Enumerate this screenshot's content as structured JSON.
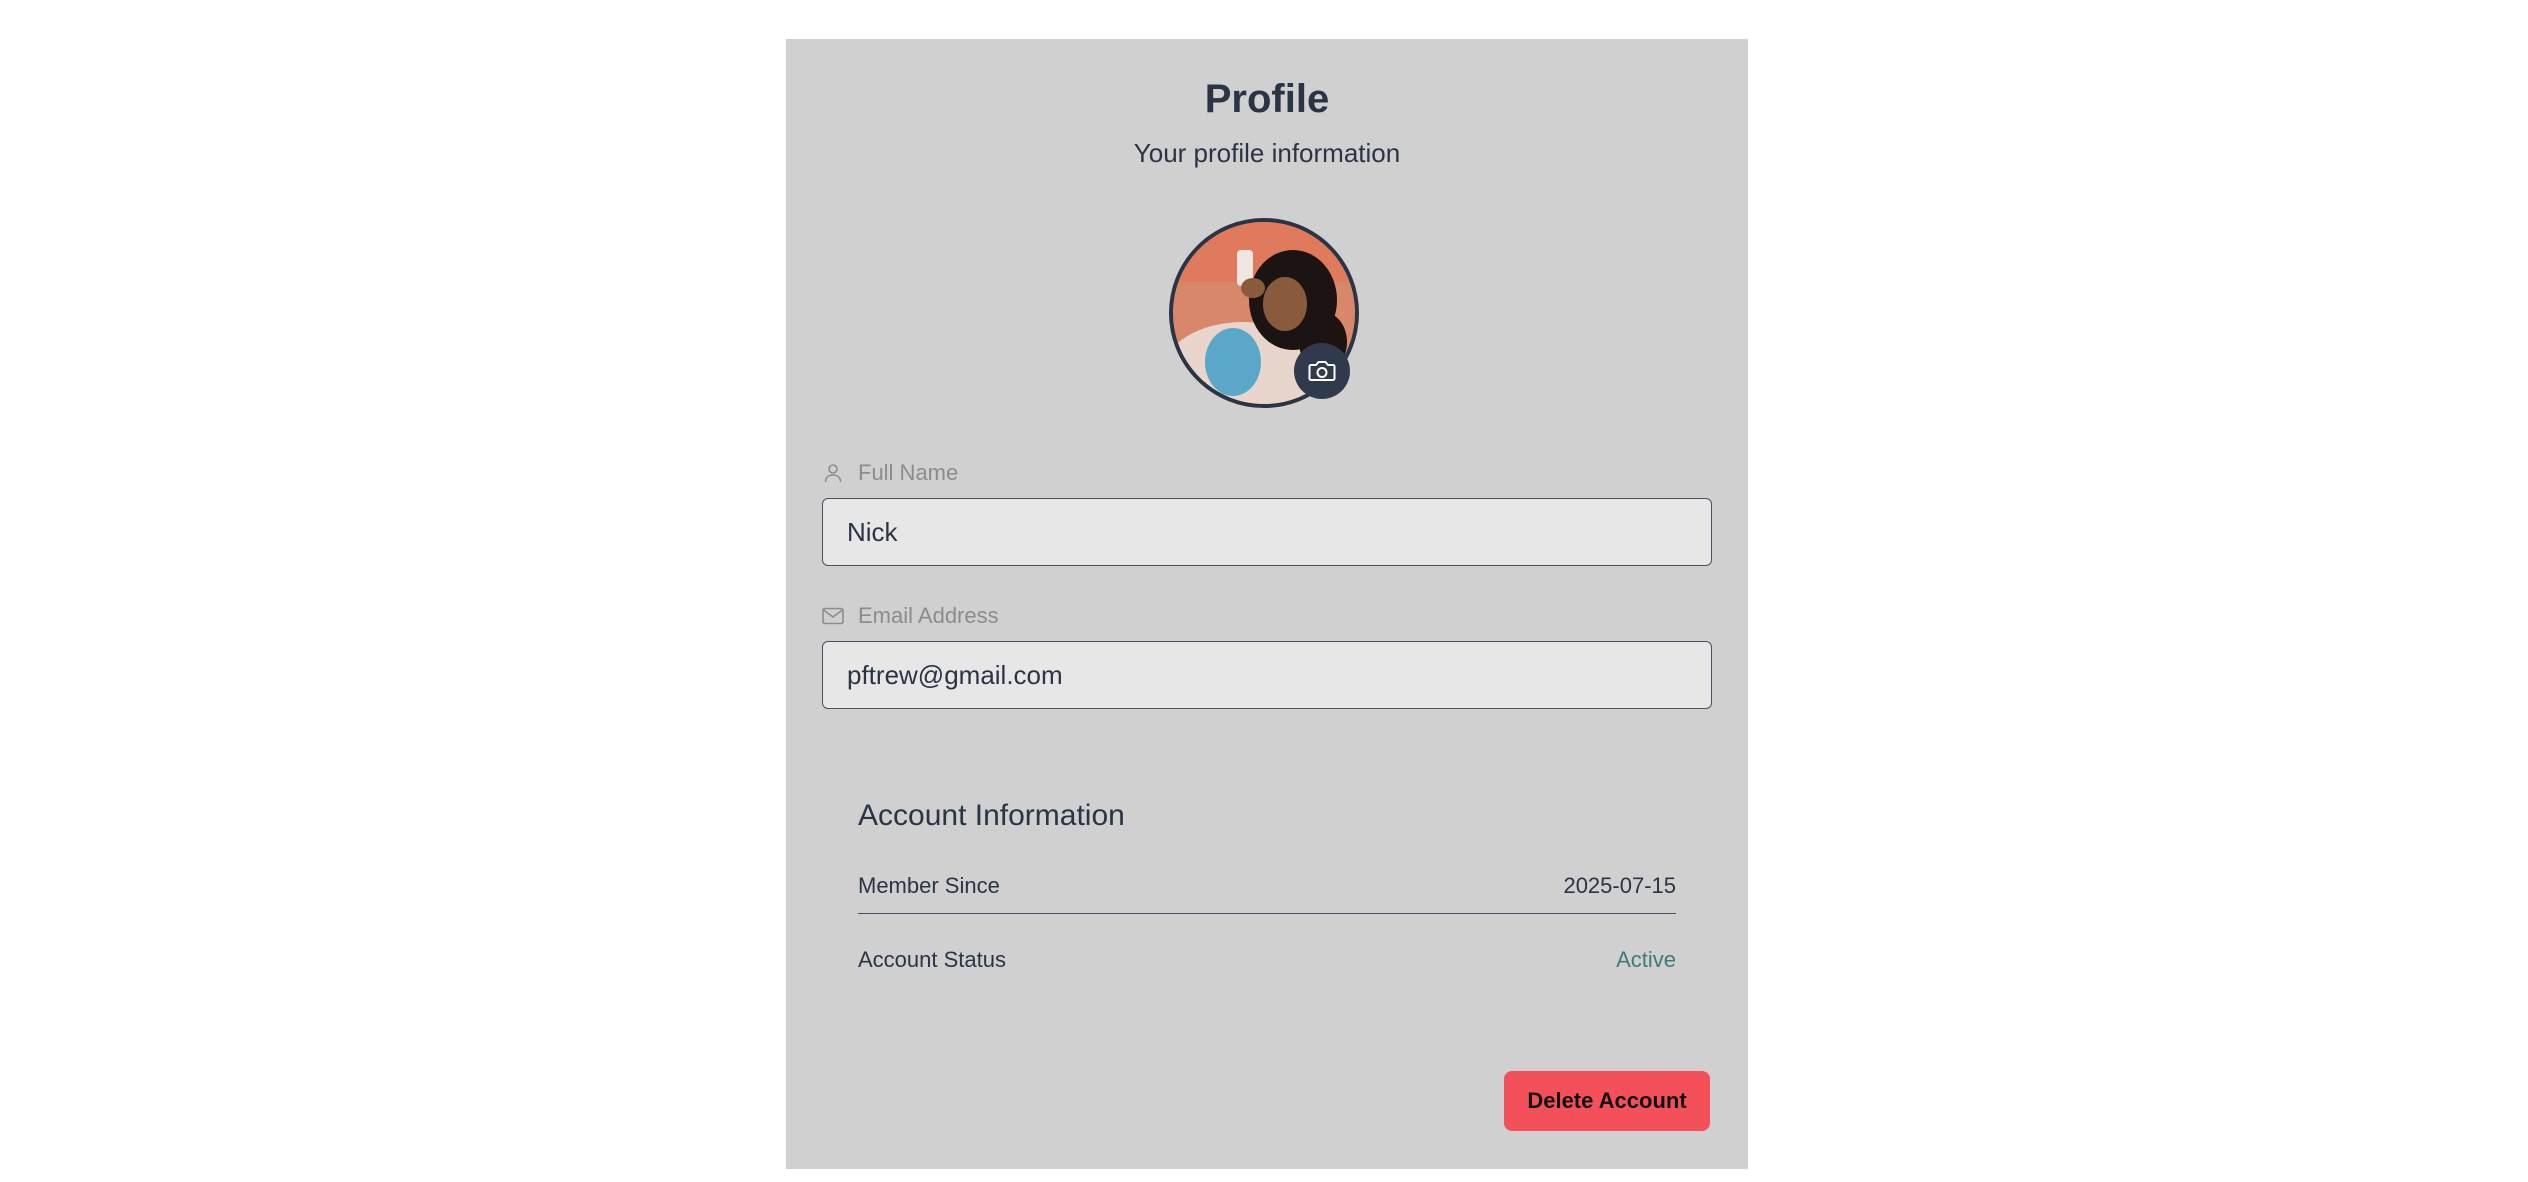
{
  "header": {
    "title": "Profile",
    "subtitle": "Your profile information"
  },
  "avatar": {
    "icon": "camera-icon"
  },
  "fields": {
    "full_name": {
      "label": "Full Name",
      "icon": "user-icon",
      "value": "Nick"
    },
    "email": {
      "label": "Email Address",
      "icon": "mail-icon",
      "value": "pftrew@gmail.com"
    }
  },
  "account_info": {
    "title": "Account Information",
    "member_since_label": "Member Since",
    "member_since_value": "2025-07-15",
    "status_label": "Account Status",
    "status_value": "Active"
  },
  "actions": {
    "delete_label": "Delete Account"
  },
  "colors": {
    "card_background": "#d0d0d0",
    "text_primary": "#2b3445",
    "status_active": "#3e7a7e",
    "danger": "#f4505a"
  }
}
